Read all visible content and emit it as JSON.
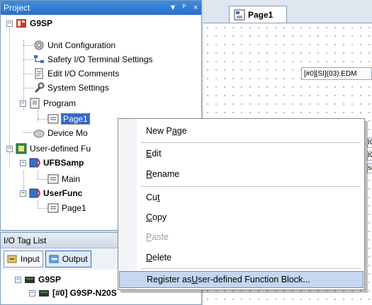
{
  "project_panel": {
    "title": "Project",
    "controls": [
      "▼",
      "ᵖ",
      "×"
    ],
    "tree": [
      {
        "label": "G9SP",
        "bold": true,
        "expander": "−"
      },
      {
        "label": "Unit Configuration"
      },
      {
        "label": "Safety I/O Terminal Settings"
      },
      {
        "label": "Edit I/O Comments"
      },
      {
        "label": "System Settings"
      },
      {
        "label": "Program",
        "expander": "−"
      },
      {
        "label": "Page1",
        "selected": true
      },
      {
        "label": "Device Mo"
      },
      {
        "label": "User-defined Fu",
        "expander": "−"
      },
      {
        "label": "UFBSamp",
        "bold": true,
        "expander": "−"
      },
      {
        "label": "Main"
      },
      {
        "label": "UserFunc",
        "bold": true,
        "expander": "−"
      },
      {
        "label": "Page1"
      }
    ]
  },
  "io_panel": {
    "title": "I/O Tag List",
    "input_label": "Input",
    "output_label": "Output",
    "tree": [
      {
        "label": "G9SP",
        "expander": "−"
      },
      {
        "label": "[#0] G9SP-N20S",
        "expander": "−"
      }
    ]
  },
  "editor": {
    "tab_label": "Page1",
    "edm_label": "[#0][SI](03):EDM",
    "stub_labels": [
      "IO",
      "IO",
      "se"
    ]
  },
  "context_menu": {
    "items": [
      {
        "pre": "New P",
        "u": "a",
        "post": "ge"
      },
      {
        "pre": "",
        "u": "E",
        "post": "dit"
      },
      {
        "pre": "",
        "u": "R",
        "post": "ename"
      },
      {
        "pre": "Cu",
        "u": "t",
        "post": ""
      },
      {
        "pre": "",
        "u": "C",
        "post": "opy"
      },
      {
        "pre": "",
        "u": "P",
        "post": "aste"
      },
      {
        "pre": "",
        "u": "D",
        "post": "elete"
      },
      {
        "pre": "Register as ",
        "u": "U",
        "post": "ser-defined Function Block..."
      }
    ]
  },
  "colors": {
    "title_bar": "#2a6fc8",
    "selection": "#316ac5",
    "menu_highlight": "#c4d6f0"
  }
}
